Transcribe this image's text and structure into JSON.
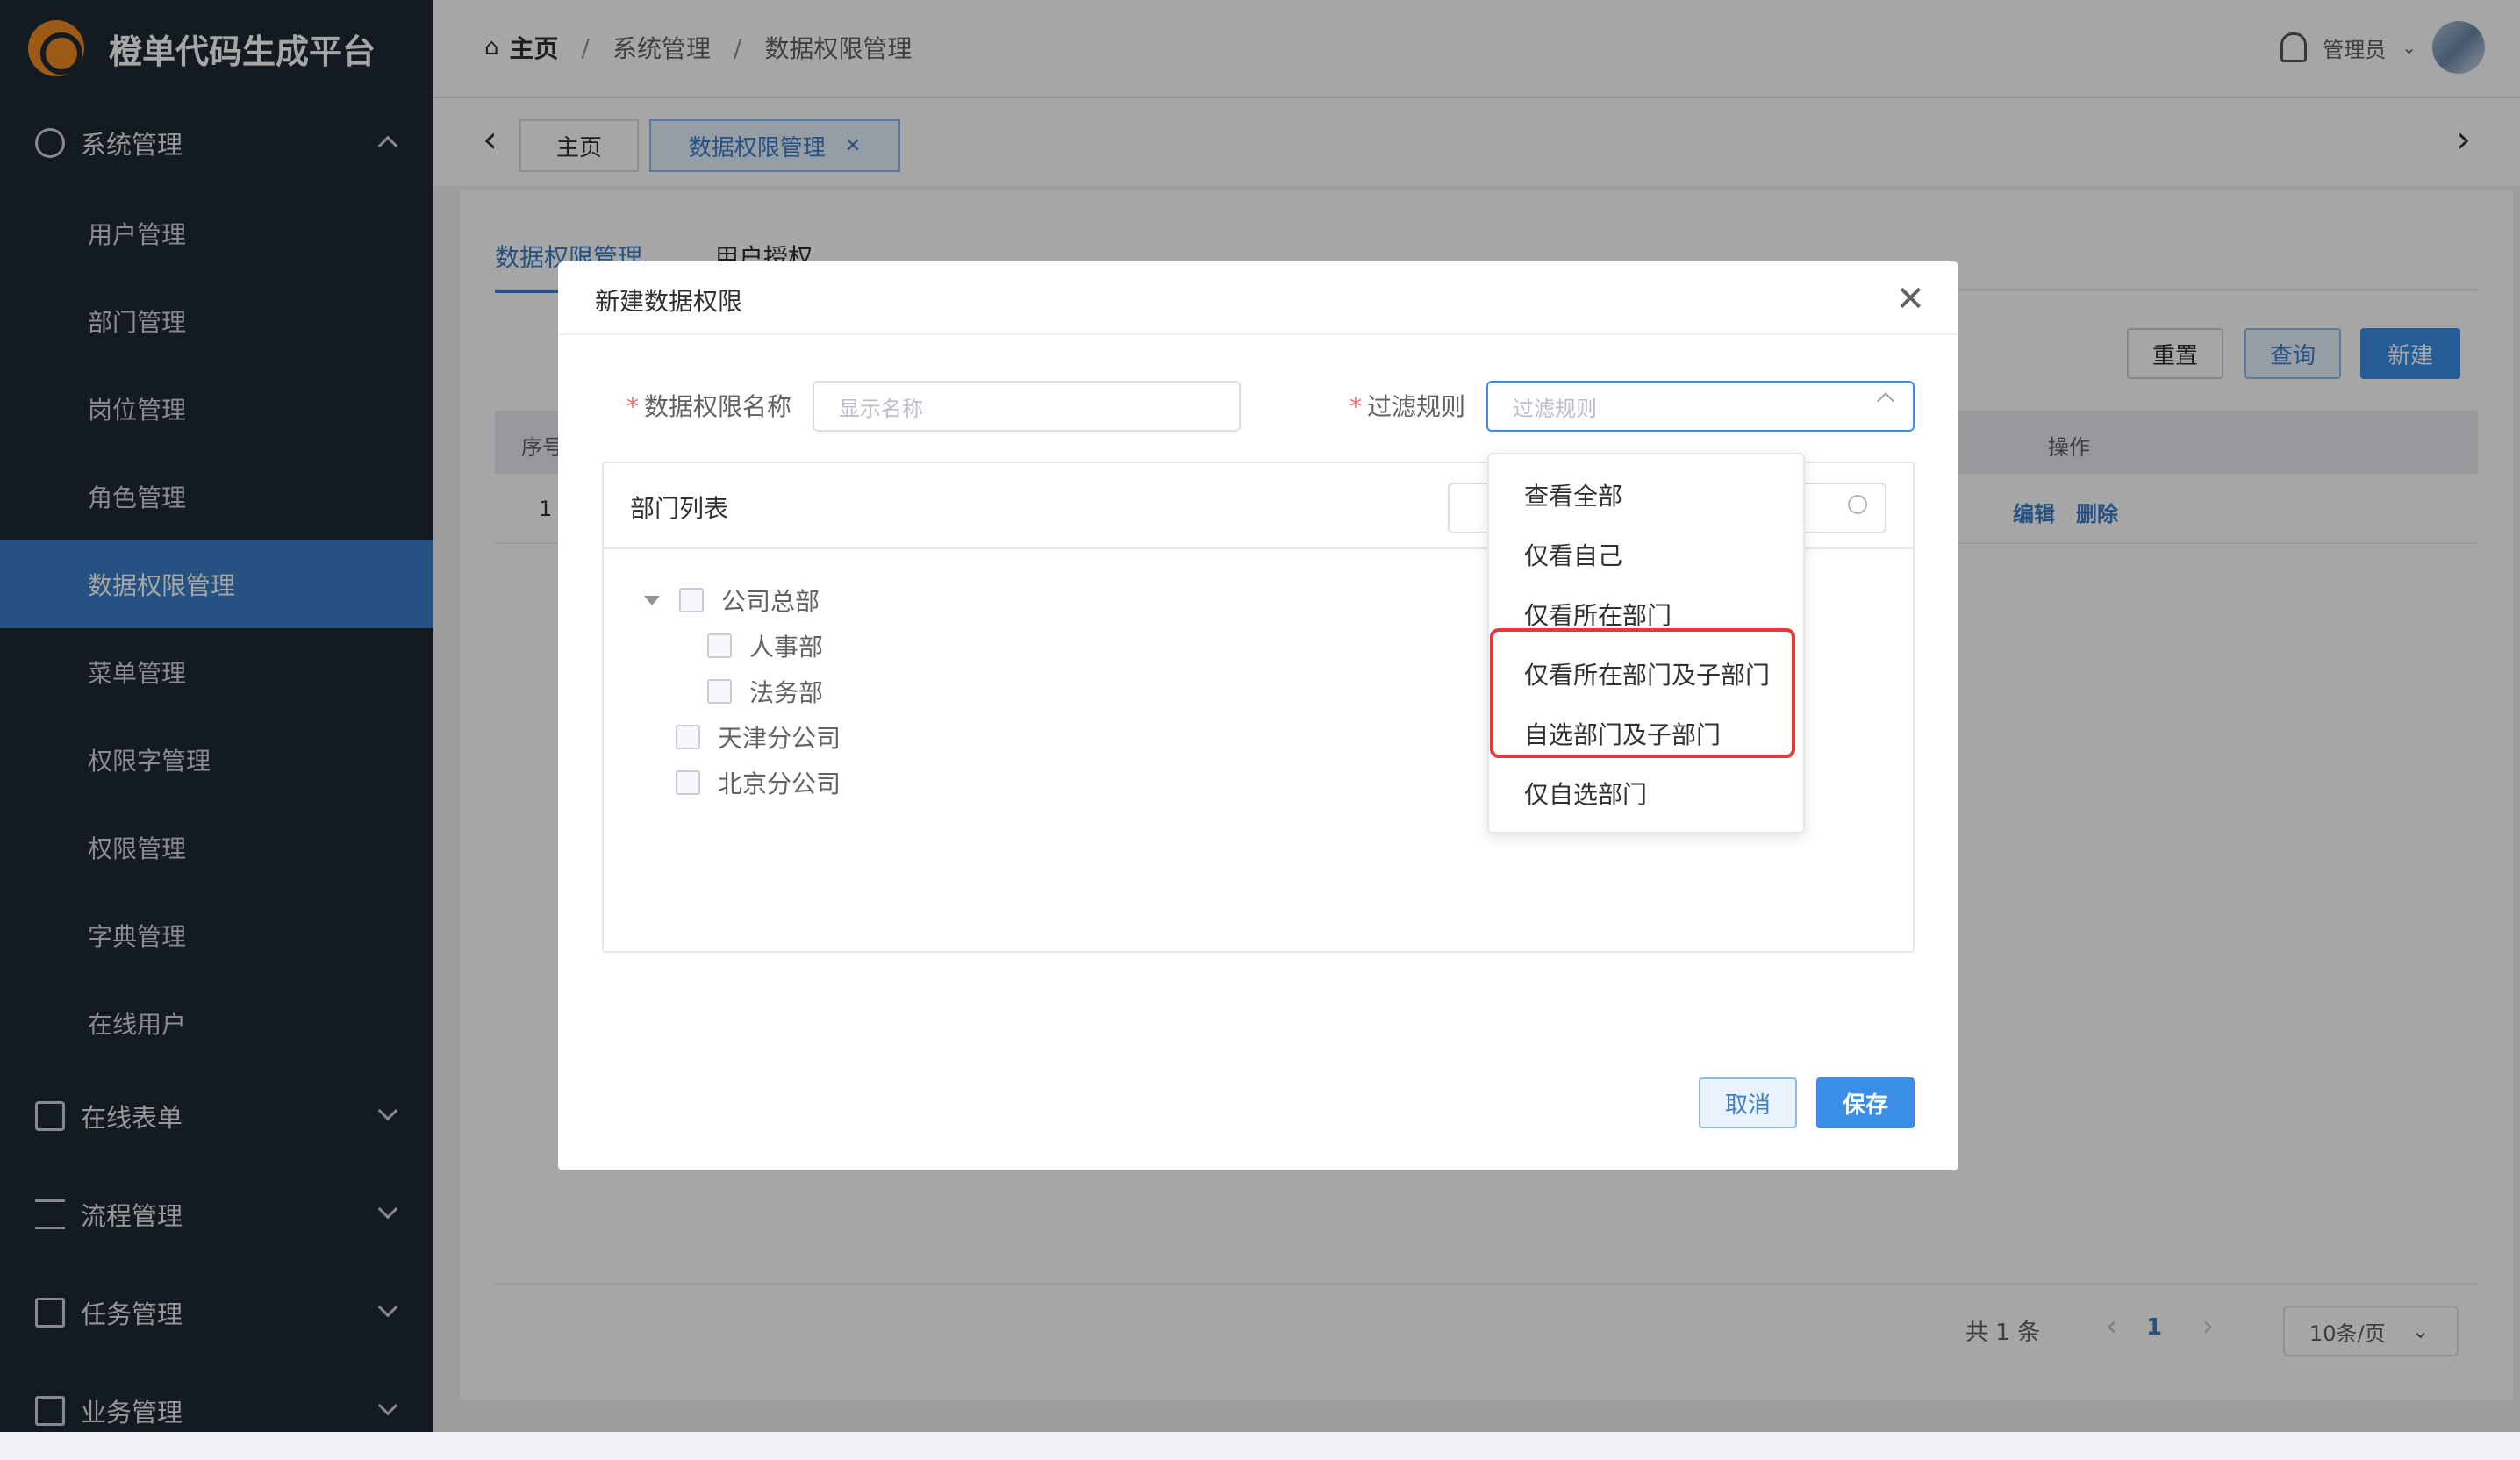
{
  "app": {
    "title": "橙单代码生成平台"
  },
  "sidebar": {
    "group_system": "系统管理",
    "items": [
      "用户管理",
      "部门管理",
      "岗位管理",
      "角色管理",
      "数据权限管理",
      "菜单管理",
      "权限字管理",
      "权限管理",
      "字典管理",
      "在线用户"
    ],
    "active_index": 4,
    "groups_below": [
      "在线表单",
      "流程管理",
      "任务管理",
      "业务管理"
    ]
  },
  "header": {
    "breadcrumb": [
      "主页",
      "系统管理",
      "数据权限管理"
    ],
    "separator": "/",
    "user": "管理员"
  },
  "tabs": {
    "home": "主页",
    "current": "数据权限管理",
    "close": "✕",
    "prev": "‹",
    "next": "›"
  },
  "main": {
    "tabs": [
      "数据权限管理",
      "用户授权"
    ],
    "buttons": {
      "reset": "重置",
      "query": "查询",
      "create": "新建"
    },
    "table": {
      "col_index": "序号",
      "col_ops": "操作",
      "row_index": "1",
      "edit": "编辑",
      "delete": "删除"
    },
    "pager": {
      "total": "共 1 条",
      "page": "1",
      "size": "10条/页"
    }
  },
  "modal": {
    "title": "新建数据权限",
    "name_label": "数据权限名称",
    "name_placeholder": "显示名称",
    "rule_label": "过滤规则",
    "rule_placeholder": "过滤规则",
    "required_mark": "*",
    "panel_title": "部门列表",
    "tree": [
      {
        "label": "公司总部",
        "level": 0,
        "expandable": true
      },
      {
        "label": "人事部",
        "level": 1
      },
      {
        "label": "法务部",
        "level": 1
      },
      {
        "label": "天津分公司",
        "level": 0
      },
      {
        "label": "北京分公司",
        "level": 0
      }
    ],
    "cancel": "取消",
    "save": "保存"
  },
  "dropdown": {
    "options": [
      "查看全部",
      "仅看自己",
      "仅看所在部门",
      "仅看所在部门及子部门",
      "自选部门及子部门",
      "仅自选部门"
    ],
    "highlighted": [
      3,
      4
    ]
  },
  "colors": {
    "accent": "#3a8ee6",
    "sidebar_bg": "#1f2933",
    "active_menu": "#3a7fc8",
    "highlight": "#e53935"
  }
}
